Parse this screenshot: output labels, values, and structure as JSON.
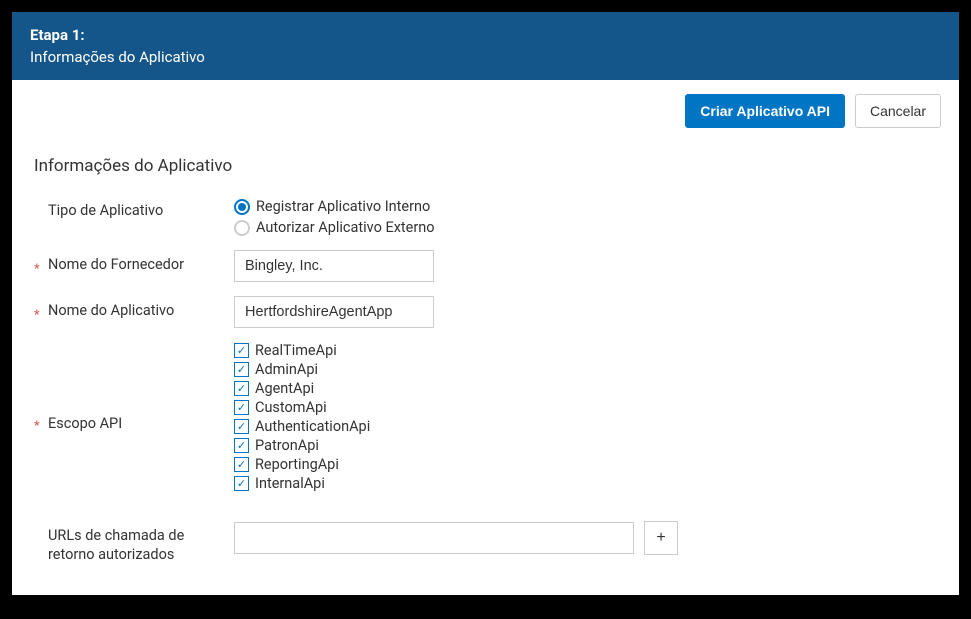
{
  "header": {
    "step": "Etapa 1:",
    "subtitle": "Informações do Aplicativo"
  },
  "actions": {
    "create_label": "Criar Aplicativo API",
    "cancel_label": "Cancelar"
  },
  "section": {
    "title": "Informações do Aplicativo"
  },
  "form": {
    "app_type": {
      "label": "Tipo de Aplicativo",
      "options": {
        "internal": "Registrar Aplicativo Interno",
        "external": "Autorizar Aplicativo Externo"
      }
    },
    "vendor_name": {
      "label": "Nome do Fornecedor",
      "value": "Bingley, Inc."
    },
    "app_name": {
      "label": "Nome do Aplicativo",
      "value": "HertfordshireAgentApp"
    },
    "api_scope": {
      "label": "Escopo API",
      "items": {
        "realtime": "RealTimeApi",
        "admin": "AdminApi",
        "agent": "AgentApi",
        "custom": "CustomApi",
        "auth": "AuthenticationApi",
        "patron": "PatronApi",
        "reporting": "ReportingApi",
        "internal": "InternalApi"
      }
    },
    "callback_urls": {
      "label": "URLs de chamada de retorno autorizados",
      "value": "",
      "add_label": "+"
    }
  }
}
